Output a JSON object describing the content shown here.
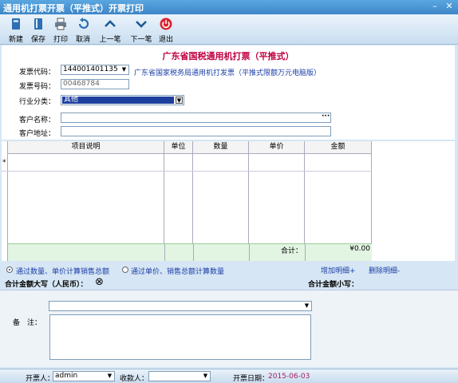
{
  "window": {
    "title": "通用机打票开票（平推式）开票打印",
    "minimize": "–",
    "close": "✕"
  },
  "toolbar": {
    "new": "新建",
    "save": "保存",
    "print": "打印",
    "cancel": "取消",
    "prev": "上一笔",
    "next": "下一笔",
    "exit": "退出"
  },
  "form": {
    "heading": "广东省国税通用机打票（平推式）",
    "invoice_code_label": "发票代码：",
    "invoice_code": "144001401135",
    "invoice_code_note": "广东省国家税务局通用机打发票（平推式限额万元电脑版）",
    "invoice_number_label": "发票号码：",
    "invoice_number": "00468784",
    "industry_label": "行业分类：",
    "industry": "其他",
    "customer_name_label": "客户名称：",
    "customer_name": "",
    "customer_name_btn": "···",
    "customer_address_label": "客户地址：",
    "customer_address": ""
  },
  "grid": {
    "columns": [
      "项目说明",
      "单位",
      "数量",
      "单价",
      "金额"
    ],
    "new_row_marker": "*",
    "total_label": "合计：",
    "total_value": "¥0.00"
  },
  "options": {
    "calc_by_qty": "通过数量、单价计算销售总额",
    "calc_by_total": "通过单价、销售总额计算数量",
    "add_detail": "增加明细+",
    "remove_detail": "删除明细-"
  },
  "totals": {
    "upper_label": "合计金额大写（人民币）：",
    "upper_symbol": "⊗",
    "lower_label": "合计金额小写："
  },
  "remarks": {
    "label": "备　注：",
    "select_value": "",
    "text": ""
  },
  "status": {
    "drawer_label": "开票人：",
    "drawer": "admin",
    "payee_label": "收款人：",
    "payee": "",
    "date_label": "开票日期：",
    "date": "2015-06-03"
  }
}
